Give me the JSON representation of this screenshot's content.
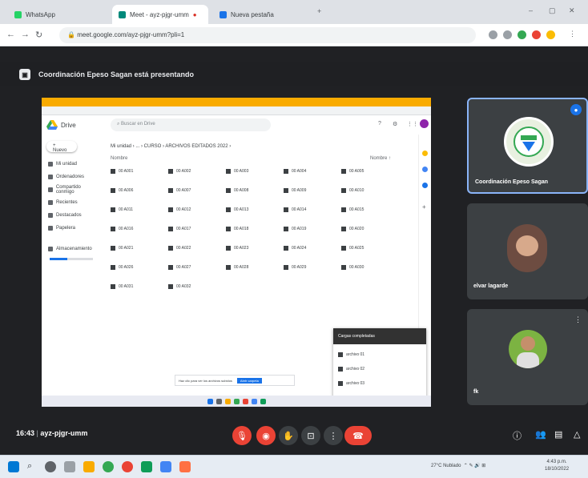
{
  "browser": {
    "tabs": [
      {
        "label": "WhatsApp",
        "color": "#25d366"
      },
      {
        "label": "Meet - ayz-pjgr-umm",
        "color": "#00897b"
      },
      {
        "label": "Nueva pestaña",
        "color": "#1a73e8"
      }
    ],
    "url": "meet.google.com/ayz-pjgr-umm?pli=1"
  },
  "meet": {
    "banner": "Coordinación Epeso Sagan está presentando",
    "drive": {
      "app_name": "Drive",
      "search_placeholder": "Buscar en Drive",
      "new_label": "Nuevo",
      "sidebar": [
        "Mi unidad",
        "Ordenadores",
        "Compartido conmigo",
        "Recientes",
        "Destacados",
        "Papelera",
        "Almacenamiento"
      ],
      "breadcrumb": "Mi unidad › ... › CURSO › ARCHIVOS EDITADOS 2022 ›",
      "column_name": "Nombre",
      "column_sort": "Nombre ↑",
      "files": [
        "00 A001",
        "00 A002",
        "00 A003",
        "00 A004",
        "00 A005",
        "00 A006",
        "00 A007",
        "00 A008",
        "00 A009",
        "00 A010",
        "00 A011",
        "00 A012",
        "00 A013",
        "00 A014",
        "00 A015",
        "00 A016",
        "00 A017",
        "00 A018",
        "00 A019",
        "00 A020",
        "00 A021",
        "00 A022",
        "00 A023",
        "00 A024",
        "00 A025",
        "00 A026",
        "00 A027",
        "00 A028",
        "00 A029",
        "00 A030",
        "00 A031",
        "00 A032"
      ],
      "upload": {
        "title": "Cargas completadas",
        "rows": [
          "archivo 01",
          "archivo 02",
          "archivo 03"
        ]
      },
      "snackbar": {
        "text": "Haz clic para ver los archivos subidos",
        "action": "Abrir carpeta"
      }
    },
    "tiles": [
      {
        "name": "Coordinación Epeso Sagan",
        "color": "#3c4043"
      },
      {
        "name": "elvar lagarde",
        "color": "#3c4043"
      },
      {
        "name": "fk",
        "color": "#3c4043"
      }
    ],
    "clock": "16:43",
    "meeting_code": "ayz-pjgr-umm"
  },
  "taskbar": {
    "weather": "27°C Nublado",
    "time": "4:43 p.m.",
    "date": "18/10/2022"
  },
  "colors": {
    "meet_bg": "#202124",
    "end_call": "#ea4335",
    "drive_yellow": "#f9ab00",
    "accent": "#8ab4f8"
  }
}
